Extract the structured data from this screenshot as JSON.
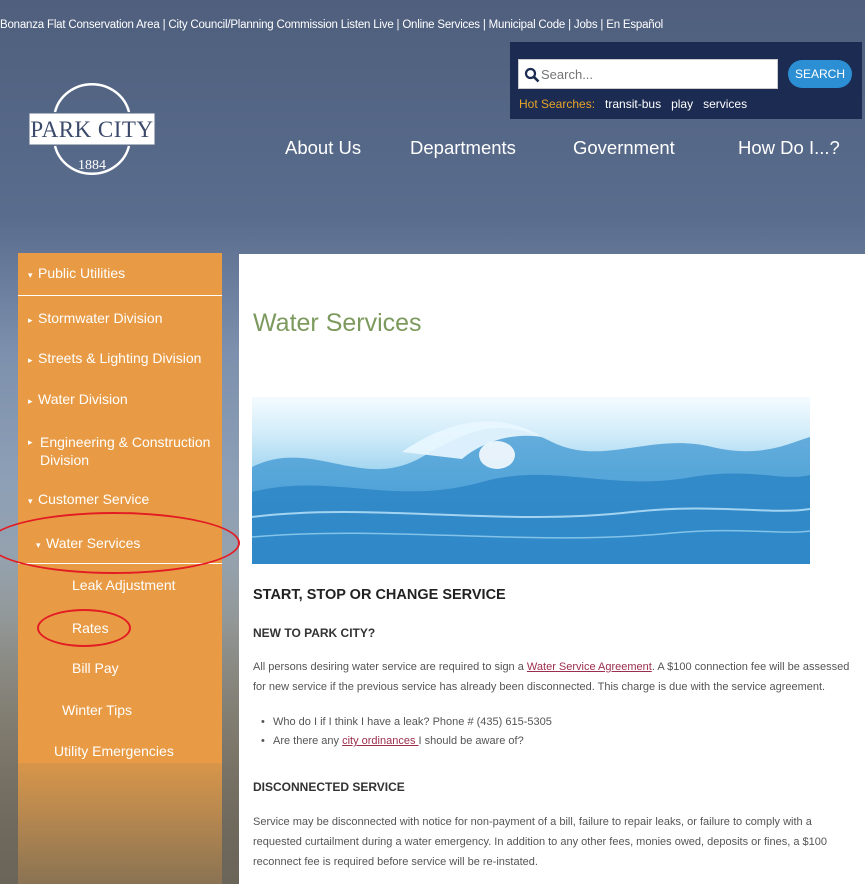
{
  "top_links": [
    "Bonanza Flat Conservation Area",
    "City Council/Planning Commission Listen Live",
    "Online Services",
    "Municipal Code",
    "Jobs",
    "En Español"
  ],
  "logo": {
    "name": "PARK CITY",
    "year": "1884"
  },
  "search": {
    "placeholder": "Search...",
    "button": "SEARCH",
    "hot_label": "Hot Searches:",
    "hot": [
      "transit-bus",
      "play",
      "services"
    ]
  },
  "nav": [
    "About Us",
    "Departments",
    "Government",
    "How Do I...?"
  ],
  "sidebar": {
    "public_utilities": "Public Utilities",
    "stormwater": "Stormwater Division",
    "streets": "Streets & Lighting Division",
    "water_division": "Water Division",
    "engineering": "Engineering & Construction Division",
    "customer_service": "Customer Service",
    "water_services": "Water Services",
    "leak_adjustment": "Leak Adjustment",
    "rates": "Rates",
    "bill_pay": "Bill Pay",
    "winter_tips": "Winter Tips",
    "utility_emergencies": "Utility Emergencies"
  },
  "content": {
    "title": "Water Services",
    "heading1": "START, STOP OR CHANGE SERVICE",
    "heading2": "NEW TO PARK CITY?",
    "para1_a": "All persons desiring water service are required to sign a ",
    "para1_link": "Water Service Agreement",
    "para1_b": ". A $100 connection fee will be assessed for new service if the previous service has already been disconnected. This charge is due with the service agreement.",
    "bullet1": "Who do I if I think I have a leak? Phone # (435) 615-5305",
    "bullet2_a": "Are there any ",
    "bullet2_link": "city ordinances ",
    "bullet2_b": "I should be aware of?",
    "heading3": "DISCONNECTED SERVICE",
    "para2": "Service may be disconnected with notice for non-payment of a bill, failure to repair leaks, or failure to comply with a requested curtailment during a water emergency. In addition to any other fees, monies owed, deposits or fines, a $100 reconnect fee is required before service will be re-instated."
  },
  "colors": {
    "sidebar": "#e89b44",
    "title": "#7d9a5e",
    "link": "#9b2e4d",
    "search_panel": "#1b2b52",
    "search_button": "#2d8fd3",
    "hot_label": "#e7a428",
    "annotation": "#e31b23"
  }
}
